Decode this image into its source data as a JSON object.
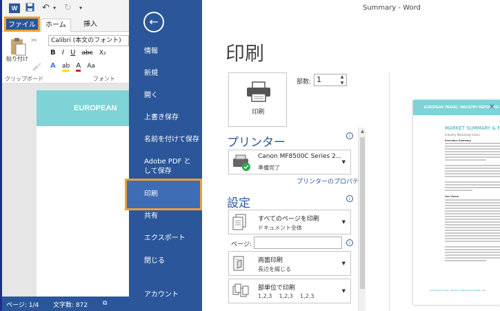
{
  "window": {
    "title": "Summary - Word"
  },
  "quick_access": {
    "app_icon": "W"
  },
  "ribbon": {
    "tabs": [
      "ファイル",
      "ホーム",
      "挿入"
    ],
    "paste_label": "貼り付け",
    "clipboard_group": "クリップボード",
    "font_name": "Calibri (本文のフォント)",
    "format_row1": [
      "B",
      "I",
      "U",
      "abc",
      "X₂"
    ],
    "format_row2": [
      "A",
      "ab",
      "A",
      "Aa"
    ],
    "font_group": "フォント"
  },
  "document": {
    "header_text": "EUROPEAN"
  },
  "statusbar": {
    "page": "ページ: 1/4",
    "words": "文字数: 872"
  },
  "backstage": {
    "nav": [
      "情報",
      "新規",
      "開く",
      "上書き保存",
      "名前を付けて保存",
      "Adobe PDF として保存",
      "印刷",
      "共有",
      "エクスポート",
      "閉じる",
      "アカウント"
    ],
    "active_item": "印刷"
  },
  "print": {
    "title": "印刷",
    "print_button": "印刷",
    "copies_label": "部数:",
    "copies_value": "1",
    "printer_heading": "プリンター",
    "printer_name": "Canon MF8500C Series 2...",
    "printer_status": "準備完了",
    "printer_properties": "プリンターのプロパティ",
    "settings_heading": "設定",
    "setting_scope_line1": "すべてのページを印刷",
    "setting_scope_line2": "ドキュメント全体",
    "pages_label": "ページ:",
    "pages_value": "",
    "setting_duplex_line1": "両面印刷",
    "setting_duplex_line2": "長辺を綴じる",
    "setting_collate_line1": "部単位で印刷",
    "setting_collate_line2": "1,2,3    1,2,3    1,2,3"
  },
  "preview": {
    "header": "EUROPEAN TRAVEL: INDUSTRY REPORTING",
    "title": "MARKET SUMMARY & F",
    "subtitle": "Industry Marketing Vision",
    "section1": "Executive Summary",
    "section2": "Our Vision",
    "footer": "100 Travel Society | 5th Ave, California CA 00000 | Tel"
  },
  "colors": {
    "accent": "#2b579a",
    "highlight": "#f0a030",
    "teal": "#7dd3d6"
  }
}
